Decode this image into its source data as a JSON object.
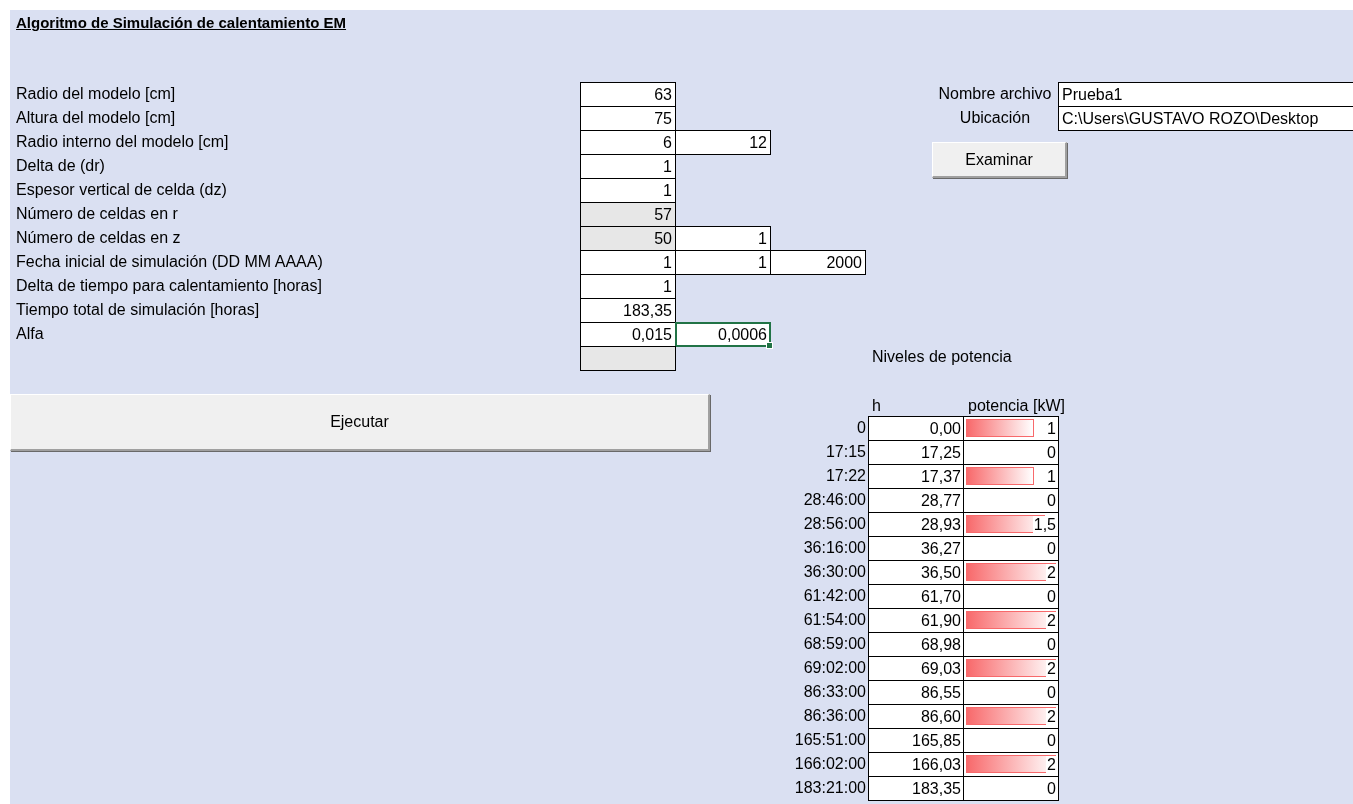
{
  "title": "Algoritmo de Simulación de calentamiento EM",
  "parameters": [
    {
      "label": "Radio del modelo [cm]",
      "cells": [
        {
          "value": "63",
          "kind": "input",
          "selected": false
        }
      ]
    },
    {
      "label": "Altura del modelo [cm]",
      "cells": [
        {
          "value": "75",
          "kind": "input",
          "selected": false
        }
      ]
    },
    {
      "label": "Radio interno del modelo [cm]",
      "cells": [
        {
          "value": "6",
          "kind": "input",
          "selected": false
        },
        {
          "value": "12",
          "kind": "input",
          "selected": false
        }
      ]
    },
    {
      "label": "Delta de (dr)",
      "cells": [
        {
          "value": "1",
          "kind": "input",
          "selected": false
        }
      ]
    },
    {
      "label": "Espesor vertical de celda (dz)",
      "cells": [
        {
          "value": "1",
          "kind": "input",
          "selected": false
        }
      ]
    },
    {
      "label": "Número de celdas en r",
      "cells": [
        {
          "value": "57",
          "kind": "computed",
          "selected": false
        }
      ]
    },
    {
      "label": "Número de celdas en z",
      "cells": [
        {
          "value": "50",
          "kind": "computed",
          "selected": false
        },
        {
          "value": "1",
          "kind": "input",
          "selected": false
        }
      ]
    },
    {
      "label": "Fecha inicial de simulación (DD MM AAAA)",
      "cells": [
        {
          "value": "1",
          "kind": "input",
          "selected": false
        },
        {
          "value": "1",
          "kind": "input",
          "selected": false
        },
        {
          "value": "2000",
          "kind": "input",
          "selected": false
        }
      ]
    },
    {
      "label": "Delta de tiempo para calentamiento [horas]",
      "cells": [
        {
          "value": "1",
          "kind": "input",
          "selected": false
        }
      ]
    },
    {
      "label": "Tiempo total de simulación [horas]",
      "cells": [
        {
          "value": "183,35",
          "kind": "input",
          "selected": false
        }
      ]
    },
    {
      "label": "Alfa",
      "cells": [
        {
          "value": "0,015",
          "kind": "input",
          "selected": false
        },
        {
          "value": "0,0006",
          "kind": "input",
          "selected": true
        }
      ]
    },
    {
      "cells": [
        {
          "kind": "computed",
          "selected": false
        }
      ]
    }
  ],
  "file": {
    "fields": [
      {
        "label": "Nombre archivo",
        "value": "Prueba1"
      },
      {
        "label": "Ubicación",
        "value": "C:\\Users\\GUSTAVO ROZO\\Desktop"
      }
    ],
    "browse_button": "Examinar"
  },
  "run_button": "Ejecutar",
  "power_levels": {
    "title": "Niveles de potencia",
    "columns": [
      "h",
      "potencia [kW]"
    ],
    "rows": [
      {
        "time": "0",
        "hours": "0,00",
        "power": "1",
        "level": 0.75
      },
      {
        "time": "17:15",
        "hours": "17,25",
        "power": "0"
      },
      {
        "time": "17:22",
        "hours": "17,37",
        "power": "1",
        "level": 0.75
      },
      {
        "time": "28:46:00",
        "hours": "28,77",
        "power": "0"
      },
      {
        "time": "28:56:00",
        "hours": "28,93",
        "power": "1,5",
        "level": 0.875
      },
      {
        "time": "36:16:00",
        "hours": "36,27",
        "power": "0"
      },
      {
        "time": "36:30:00",
        "hours": "36,50",
        "power": "2",
        "level": 1
      },
      {
        "time": "61:42:00",
        "hours": "61,70",
        "power": "0"
      },
      {
        "time": "61:54:00",
        "hours": "61,90",
        "power": "2",
        "level": 1
      },
      {
        "time": "68:59:00",
        "hours": "68,98",
        "power": "0"
      },
      {
        "time": "69:02:00",
        "hours": "69,03",
        "power": "2",
        "level": 1
      },
      {
        "time": "86:33:00",
        "hours": "86,55",
        "power": "0"
      },
      {
        "time": "86:36:00",
        "hours": "86,60",
        "power": "2",
        "level": 1
      },
      {
        "time": "165:51:00",
        "hours": "165,85",
        "power": "0"
      },
      {
        "time": "166:02:00",
        "hours": "166,03",
        "power": "2",
        "level": 1
      },
      {
        "time": "183:21:00",
        "hours": "183,35",
        "power": "0"
      }
    ]
  }
}
